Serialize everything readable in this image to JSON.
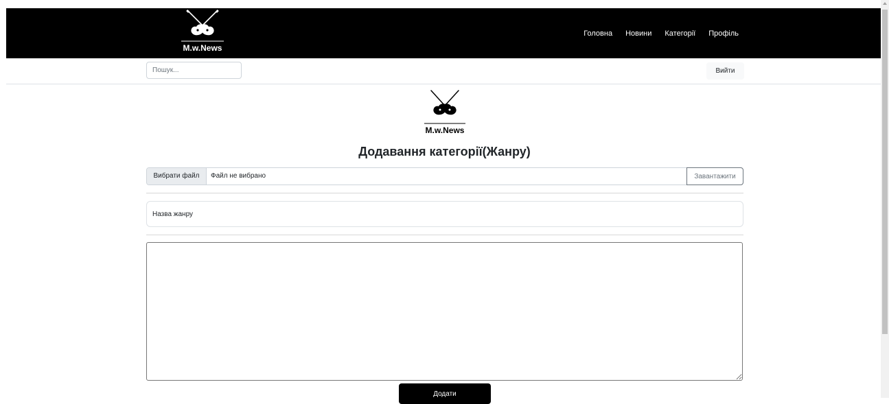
{
  "brand": {
    "logo_text": "M.w.News",
    "logo_fg": "#ffffff",
    "logo_bg": "#000000"
  },
  "nav": {
    "links": [
      {
        "label": "Головна"
      },
      {
        "label": "Новини"
      },
      {
        "label": "Категорії"
      },
      {
        "label": "Профіль"
      }
    ]
  },
  "subbar": {
    "search_placeholder": "Пошук...",
    "logout_label": "Вийти"
  },
  "main": {
    "logo_text": "M.w.News",
    "title": "Додавання категорії(Жанру)",
    "file_choose_label": "Вибрати файл",
    "file_status": "Файл не вибрано",
    "upload_label": "Завантажити",
    "genre_placeholder": "Назва жанру",
    "submit_label": "Додати"
  },
  "colors": {
    "navbar_bg": "#000000",
    "accent": "#000000"
  },
  "icons": {
    "logo": "crossed-guitars-icon",
    "scroll": "scroll-up-arrow-icon"
  }
}
